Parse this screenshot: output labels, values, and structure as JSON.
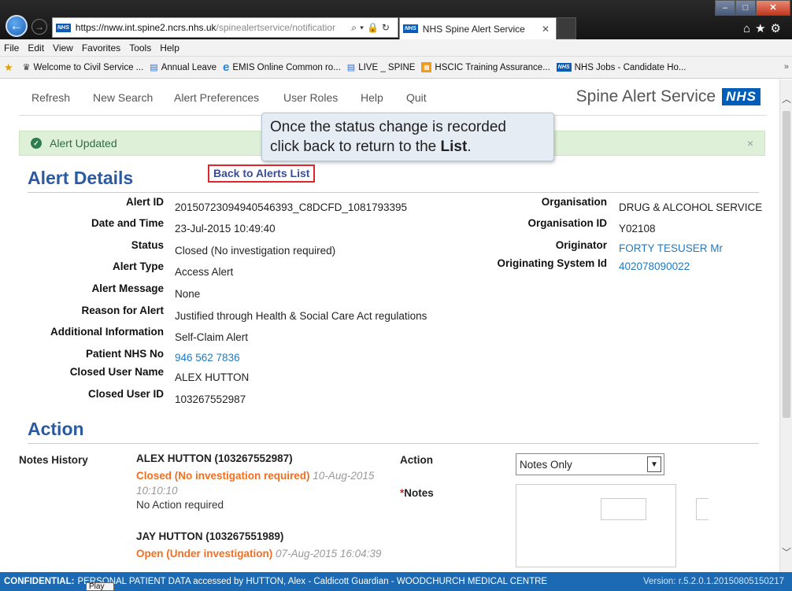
{
  "browser": {
    "url_main": "https://nww.int.spine2.ncrs.nhs.uk",
    "url_rest": "/spinealertservice/notificatior",
    "tab_title": "NHS Spine Alert Service",
    "menu": [
      "File",
      "Edit",
      "View",
      "Favorites",
      "Tools",
      "Help"
    ],
    "favorites": [
      {
        "icon": "crest-icon",
        "label": "Welcome to Civil Service ..."
      },
      {
        "icon": "page-icon",
        "label": "Annual Leave"
      },
      {
        "icon": "ie-icon",
        "label": "EMIS Online  Common ro..."
      },
      {
        "icon": "page-icon",
        "label": "LIVE _ SPINE"
      },
      {
        "icon": "orange-icon",
        "label": "HSCIC Training Assurance..."
      },
      {
        "icon": "nhs-icon",
        "label": "NHS Jobs - Candidate Ho..."
      }
    ],
    "nhs_mini": "NHS"
  },
  "nav": {
    "refresh": "Refresh",
    "new_search": "New Search",
    "alert_preferences": "Alert Preferences",
    "user_roles": "User Roles",
    "help": "Help",
    "quit": "Quit",
    "brand": "Spine Alert Service",
    "logo": "NHS"
  },
  "alert": {
    "message": "Alert Updated",
    "close": "×"
  },
  "tooltip": {
    "line1": "Once the status change is recorded",
    "line2_prefix": "click back to return to the ",
    "line2_bold": "List",
    "line2_suffix": "."
  },
  "back_to_list": "Back to Alerts List",
  "details": {
    "heading": "Alert Details",
    "left": [
      {
        "label": "Alert ID",
        "value": "20150723094940546393_C8DCFD_1081793395"
      },
      {
        "label": "Date and Time",
        "value": "23-Jul-2015 10:49:40"
      },
      {
        "label": "Status",
        "value": "Closed (No investigation required)"
      },
      {
        "label": "Alert Type",
        "value": "Access Alert"
      },
      {
        "label": "Alert Message",
        "value": "None"
      },
      {
        "label": "Reason for Alert",
        "value": "Justified through Health & Social Care Act regulations"
      },
      {
        "label": "Additional Information",
        "value": "Self-Claim Alert"
      },
      {
        "label": "Patient NHS No",
        "value": "946 562 7836"
      },
      {
        "label": "Closed User Name",
        "value": "ALEX HUTTON"
      },
      {
        "label": "Closed User ID",
        "value": "103267552987"
      }
    ],
    "right": [
      {
        "label": "Organisation",
        "value": "DRUG & ALCOHOL SERVICE"
      },
      {
        "label": "Organisation ID",
        "value": "Y02108"
      },
      {
        "label": "Originator",
        "value": "FORTY TESUSER Mr"
      },
      {
        "label": "Originating System Id",
        "value": "402078090022"
      }
    ]
  },
  "action": {
    "heading": "Action",
    "notes_history_label": "Notes History",
    "notes": [
      {
        "user": "ALEX HUTTON (103267552987)",
        "status": "Closed (No investigation required)",
        "date": "10-Aug-2015 10:10:10",
        "text": "No Action required"
      },
      {
        "user": "JAY HUTTON (103267551989)",
        "status": "Open (Under investigation)",
        "date": "07-Aug-2015 16:04:39",
        "text": ""
      }
    ],
    "action_label": "Action",
    "notes_label": "Notes",
    "required_mark": "*",
    "selected_action": "Notes Only"
  },
  "footer": {
    "confidential_label": "CONFIDENTIAL:",
    "text": "PERSONAL PATIENT DATA accessed by HUTTON, Alex - Caldicott Guardian - WOODCHURCH MEDICAL CENTRE",
    "version": "Version: r.5.2.0.1.20150805150217",
    "play": "Play"
  }
}
